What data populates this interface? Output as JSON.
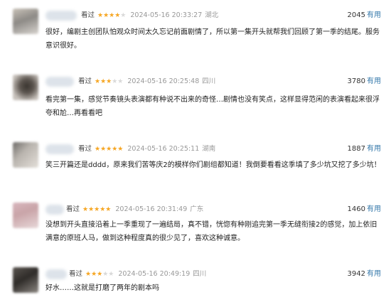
{
  "reviews": [
    {
      "watched": "看过",
      "stars_on": 4,
      "time": "2024-05-16 20:33:27",
      "location": "湖北",
      "useful_count": "2045",
      "useful_label": "有用",
      "content": "很好，编剧主创团队怕观众时间太久忘记前面剧情了，所以第一集开头就帮我们回顾了第一季的结尾。服务意识很好。"
    },
    {
      "watched": "看过",
      "stars_on": 3,
      "time": "2024-05-16 20:25:48",
      "location": "四川",
      "useful_count": "3780",
      "useful_label": "有用",
      "content": "看完第一集，感觉节奏镜头表演都有种说不出来的奇怪…剧情也没有笑点，这样显得范闲的表演看起来很浮夸和尬…再看看吧"
    },
    {
      "watched": "看过",
      "stars_on": 5,
      "time": "2024-05-16 20:25:11",
      "location": "湖南",
      "useful_count": "1887",
      "useful_label": "有用",
      "content": "笑三开篇还是dddd，原来我们苦等庆2的模样你们剧组都知道！我倒要看看这季填了多少坑又挖了多少坑！"
    },
    {
      "watched": "看过",
      "stars_on": 5,
      "time": "2024-05-16 20:31:49",
      "location": "广东",
      "useful_count": "1460",
      "useful_label": "有用",
      "content": "没想到开头直接沿着上一季重现了一遍结局，真不错，恍惚有种刚追完第一季无缝衔接2的感觉，加上依旧满意的原班人马，做到这种程度真的很少见了，喜欢这种诚意。"
    },
    {
      "watched": "看过",
      "stars_on": 3,
      "time": "2024-05-16 20:49:19",
      "location": "四川",
      "useful_count": "3942",
      "useful_label": "有用",
      "content": "好水……这就是打磨了两年的剧本吗"
    }
  ],
  "colors": {
    "star": "#f6a623",
    "star_off": "#d9d9d9",
    "useful_link": "#3377aa",
    "meta_gray": "#999999"
  }
}
